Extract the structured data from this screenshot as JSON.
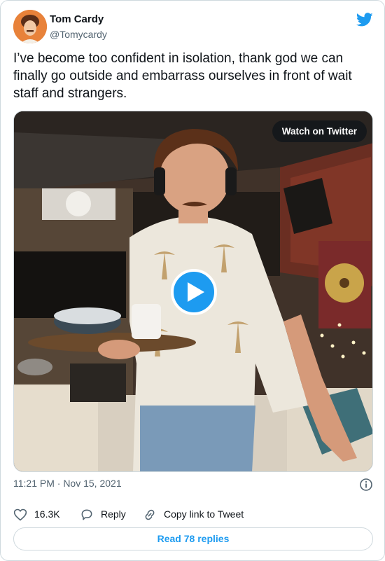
{
  "author": {
    "name": "Tom Cardy",
    "handle": "@Tomycardy"
  },
  "tweet": {
    "text": "I’ve become too confident in isolation, thank god we can finally go outside and embarrass ourselves in front of wait staff and strangers.",
    "timestamp": "11:21 PM · Nov 15, 2021"
  },
  "media": {
    "watch_label": "Watch on Twitter"
  },
  "actions": {
    "like_count": "16.3K",
    "reply_label": "Reply",
    "copy_label": "Copy link to Tweet"
  },
  "footer": {
    "read_replies_label": "Read 78 replies"
  },
  "colors": {
    "accent": "#1d9bf0",
    "text_primary": "#0f1419",
    "text_secondary": "#536471",
    "border": "#cfd9de"
  },
  "icons": [
    "twitter-bird-icon",
    "play-icon",
    "info-icon",
    "heart-icon",
    "reply-icon",
    "link-icon"
  ]
}
